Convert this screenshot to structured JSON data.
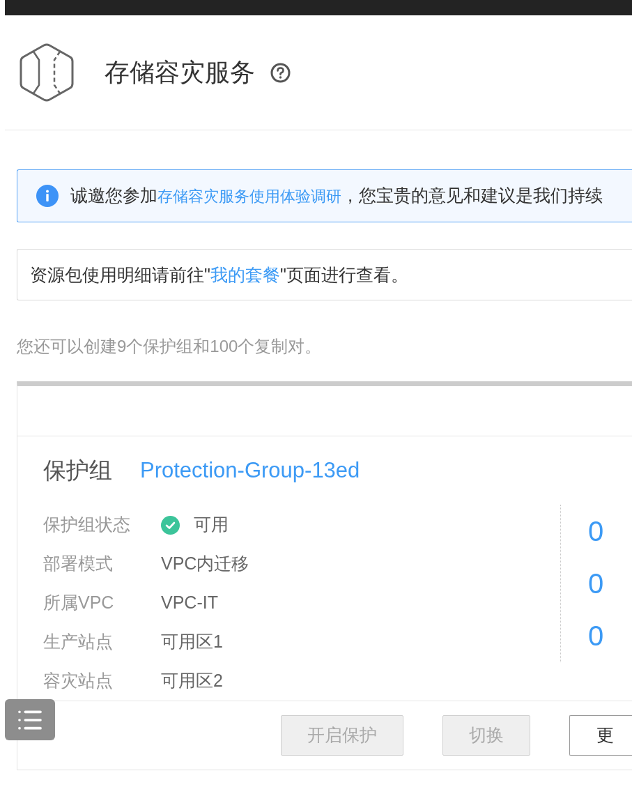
{
  "header": {
    "title": "存储容灾服务"
  },
  "survey_banner": {
    "text_before": "诚邀您参加",
    "link": "存储容灾服务使用体验调研",
    "text_after": "，您宝贵的意见和建议是我们持续"
  },
  "package_notice": {
    "text_before": "资源包使用明细请前往\"",
    "link": "我的套餐",
    "text_after": "\"页面进行查看。"
  },
  "quota_note": "您还可以创建9个保护组和100个复制对。",
  "protection_group": {
    "label": "保护组",
    "name": "Protection-Group-13ed",
    "details": [
      {
        "label": "保护组状态",
        "value": "可用",
        "kind": "status"
      },
      {
        "label": "部署模式",
        "value": "VPC内迁移",
        "kind": "text"
      },
      {
        "label": "所属VPC",
        "value": "VPC-IT",
        "kind": "text"
      },
      {
        "label": "生产站点",
        "value": "可用区1",
        "kind": "text"
      },
      {
        "label": "容灾站点",
        "value": "可用区2",
        "kind": "text"
      }
    ],
    "summary_numbers": [
      "0",
      "0",
      "0"
    ],
    "buttons": [
      {
        "label": "开启保护",
        "disabled": true
      },
      {
        "label": "切换",
        "disabled": true
      },
      {
        "label": "更",
        "disabled": false
      }
    ]
  }
}
